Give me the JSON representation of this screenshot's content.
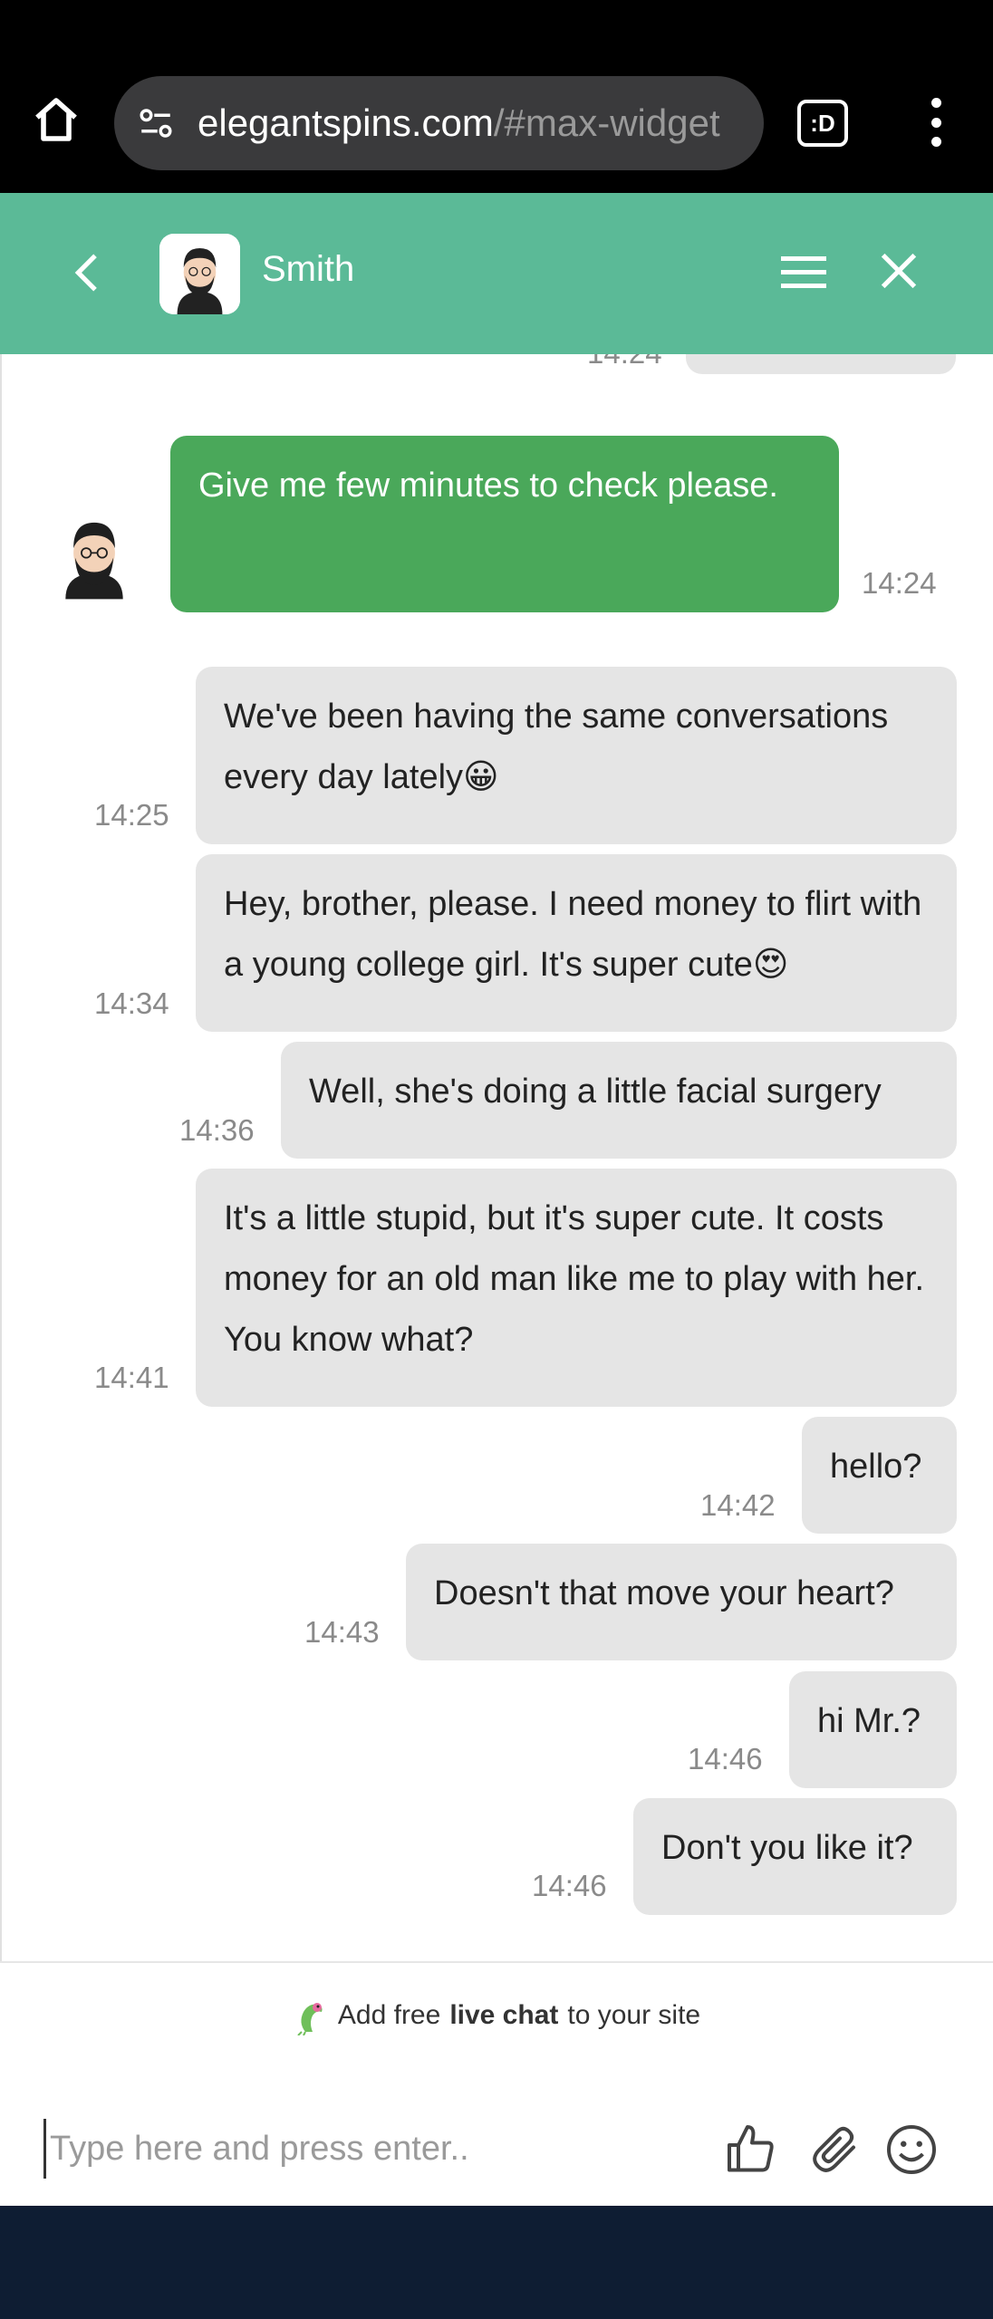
{
  "browser": {
    "url_host": "elegantspins.com",
    "url_path": "/#max-widget",
    "tabs_label": ":D"
  },
  "header": {
    "agent_name": "Smith",
    "color": "#5bba97"
  },
  "messages": [
    {
      "id": "m0",
      "text": "",
      "time": "14:24",
      "sender": "visitor"
    },
    {
      "id": "m1",
      "text": "Give me few minutes to check please.",
      "time": "14:24",
      "sender": "agent"
    },
    {
      "id": "m2",
      "text": "We've been having the same conversations every day lately😀",
      "time": "14:25",
      "sender": "visitor"
    },
    {
      "id": "m3",
      "text": "Hey, brother, please. I need money to flirt with a young college girl. It's super cute😍",
      "time": "14:34",
      "sender": "visitor"
    },
    {
      "id": "m4",
      "text": "Well, she's doing a little facial surgery",
      "time": "14:36",
      "sender": "visitor"
    },
    {
      "id": "m5",
      "text": "It's a little stupid, but it's super cute. It costs money for an old man like me to play with her. You know what?",
      "time": "14:41",
      "sender": "visitor"
    },
    {
      "id": "m6",
      "text": "hello?",
      "time": "14:42",
      "sender": "visitor"
    },
    {
      "id": "m7",
      "text": "Doesn't that move your heart?",
      "time": "14:43",
      "sender": "visitor"
    },
    {
      "id": "m8",
      "text": "hi Mr.?",
      "time": "14:46",
      "sender": "visitor"
    },
    {
      "id": "m9",
      "text": "Don't you like it?",
      "time": "14:46",
      "sender": "visitor"
    }
  ],
  "footer": {
    "promo_prefix": "Add free",
    "promo_bold": "live chat",
    "promo_suffix": "to your site",
    "input_placeholder": "Type here and press enter.."
  },
  "colors": {
    "agent_bubble": "#4aa85a",
    "visitor_bubble": "#e5e5e5",
    "bottom_band": "#0e1d33"
  }
}
